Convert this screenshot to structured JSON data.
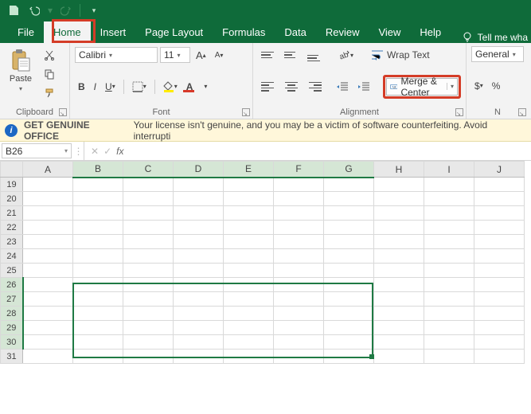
{
  "qat": {
    "save": "save",
    "undo": "undo",
    "redo": "redo"
  },
  "tabs": {
    "file": "File",
    "home": "Home",
    "insert": "Insert",
    "pagelayout": "Page Layout",
    "formulas": "Formulas",
    "data": "Data",
    "review": "Review",
    "view": "View",
    "help": "Help",
    "tellme": "Tell me wha"
  },
  "ribbon": {
    "clipboard": {
      "paste": "Paste",
      "label": "Clipboard"
    },
    "font": {
      "name": "Calibri",
      "size": "11",
      "label": "Font"
    },
    "alignment": {
      "wrap": "Wrap Text",
      "merge": "Merge & Center",
      "label": "Alignment"
    },
    "number": {
      "format": "General",
      "label": "N"
    }
  },
  "messagebar": {
    "title": "GET GENUINE OFFICE",
    "text": "Your license isn't genuine, and you may be a victim of software counterfeiting. Avoid interrupti"
  },
  "namebox": "B26",
  "formula": "",
  "fx_label": "fx",
  "columns": [
    "A",
    "B",
    "C",
    "D",
    "E",
    "F",
    "G",
    "H",
    "I",
    "J"
  ],
  "rows": [
    19,
    20,
    21,
    22,
    23,
    24,
    25,
    26,
    27,
    28,
    29,
    30,
    31
  ],
  "selection": {
    "top_row": 26,
    "bottom_row": 30,
    "left_col": "B",
    "right_col": "G"
  }
}
